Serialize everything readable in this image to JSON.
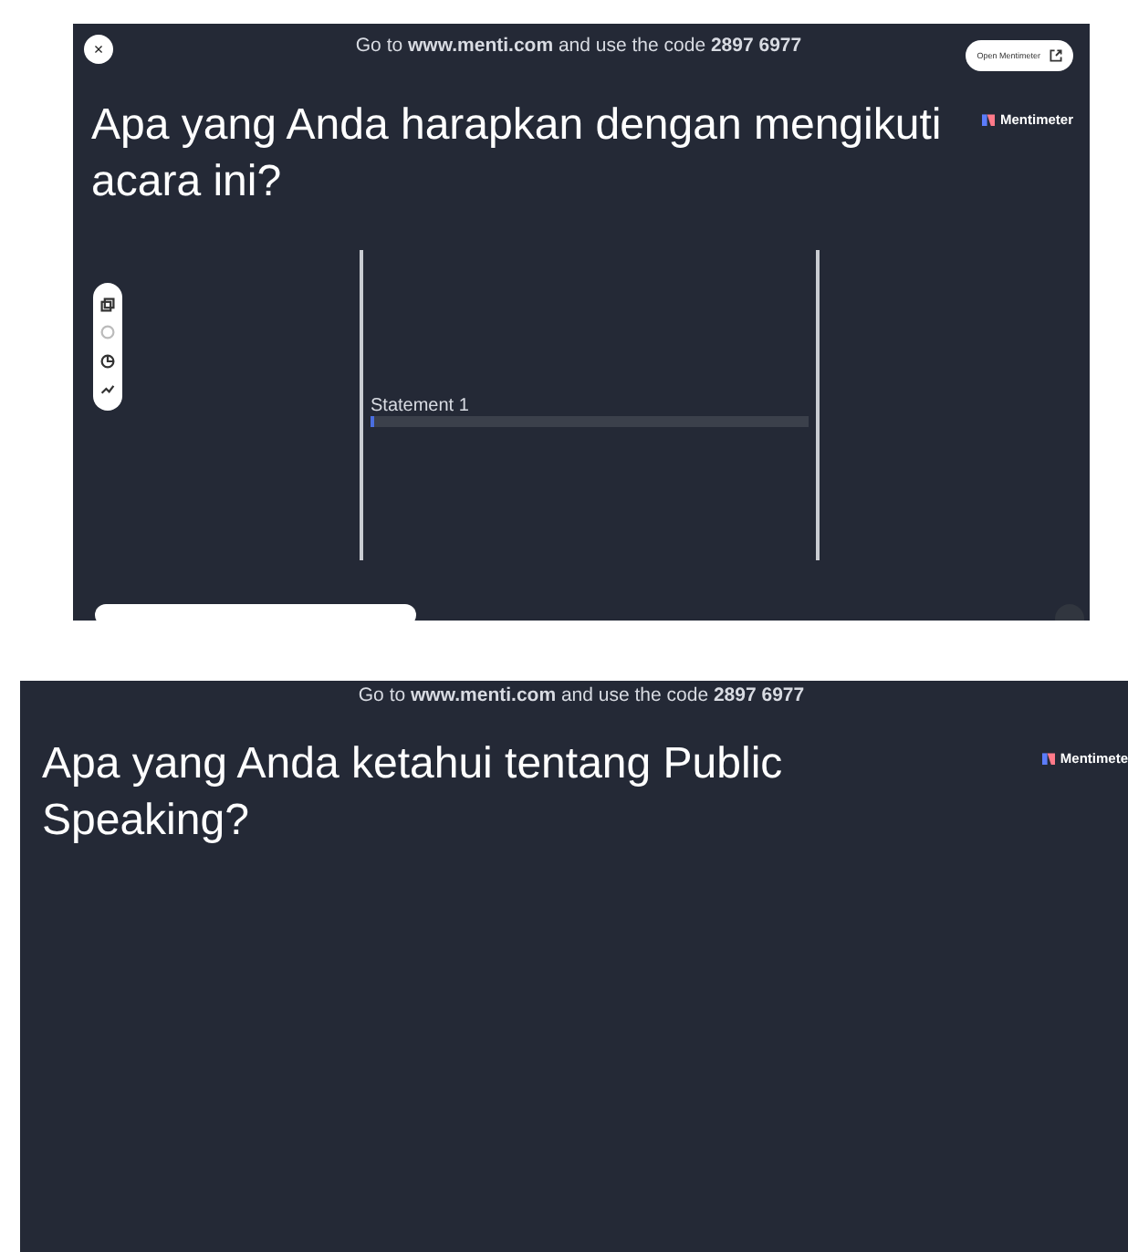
{
  "slides": [
    {
      "instruction": "Go to **www.menti.com** and use the code **2897 6977**",
      "close_label": "×",
      "open_button": "Open Mentimeter",
      "brand": "Mentimeter",
      "title": "Apa yang Anda harapkan dengan mengikuti acara ini?",
      "toolbar": [
        {
          "disabled": false
        },
        {
          "disabled": true
        },
        {
          "disabled": false
        },
        {
          "disabled": false
        }
      ],
      "statements": [
        {
          "label": "Statement 1",
          "level": 0.01
        }
      ]
    },
    {
      "instruction": "Go to **www.menti.com** and use the code **2897 6977**",
      "brand": "Mentimete",
      "title": "Apa yang Anda ketahui tentang Public Speaking?"
    }
  ]
}
